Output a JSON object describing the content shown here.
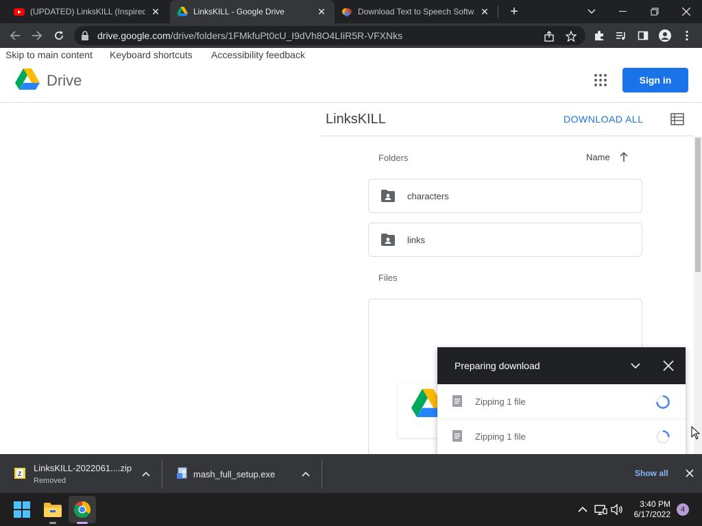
{
  "browser": {
    "tabs": [
      {
        "title": "(UPDATED) LinksKILL (Inspired By",
        "favicon": "youtube-icon",
        "active": false
      },
      {
        "title": "LinksKILL - Google Drive",
        "favicon": "google-drive-icon",
        "active": true
      },
      {
        "title": "Download Text to Speech Softwa",
        "favicon": "app-icon",
        "active": false
      }
    ],
    "url_host": "drive.google.com",
    "url_path": "/drive/folders/1FMkfuPt0cU_I9dVh8O4LIiR5R-VFXNks"
  },
  "page": {
    "skip_links": [
      "Skip to main content",
      "Keyboard shortcuts",
      "Accessibility feedback"
    ],
    "brand": "Drive",
    "sign_in": "Sign in",
    "folder_title": "LinksKILL",
    "download_all": "DOWNLOAD ALL",
    "folders_label": "Folders",
    "sort_label": "Name",
    "folders": [
      {
        "name": "characters"
      },
      {
        "name": "links"
      }
    ],
    "files_label": "Files"
  },
  "download_panel": {
    "title": "Preparing download",
    "rows": [
      {
        "label": "Zipping 1 file"
      },
      {
        "label": "Zipping 1 file"
      }
    ]
  },
  "downloads_shelf": {
    "items": [
      {
        "name": "LinksKILL-2022061....zip",
        "status": "Removed"
      },
      {
        "name": "mash_full_setup.exe",
        "status": ""
      }
    ],
    "show_all": "Show all"
  },
  "taskbar": {
    "time": "3:40 PM",
    "date": "6/17/2022",
    "notification_count": "4"
  },
  "colors": {
    "accent": "#1a73e8",
    "chrome_dark": "#202124",
    "chrome_toolbar": "#35363a"
  }
}
